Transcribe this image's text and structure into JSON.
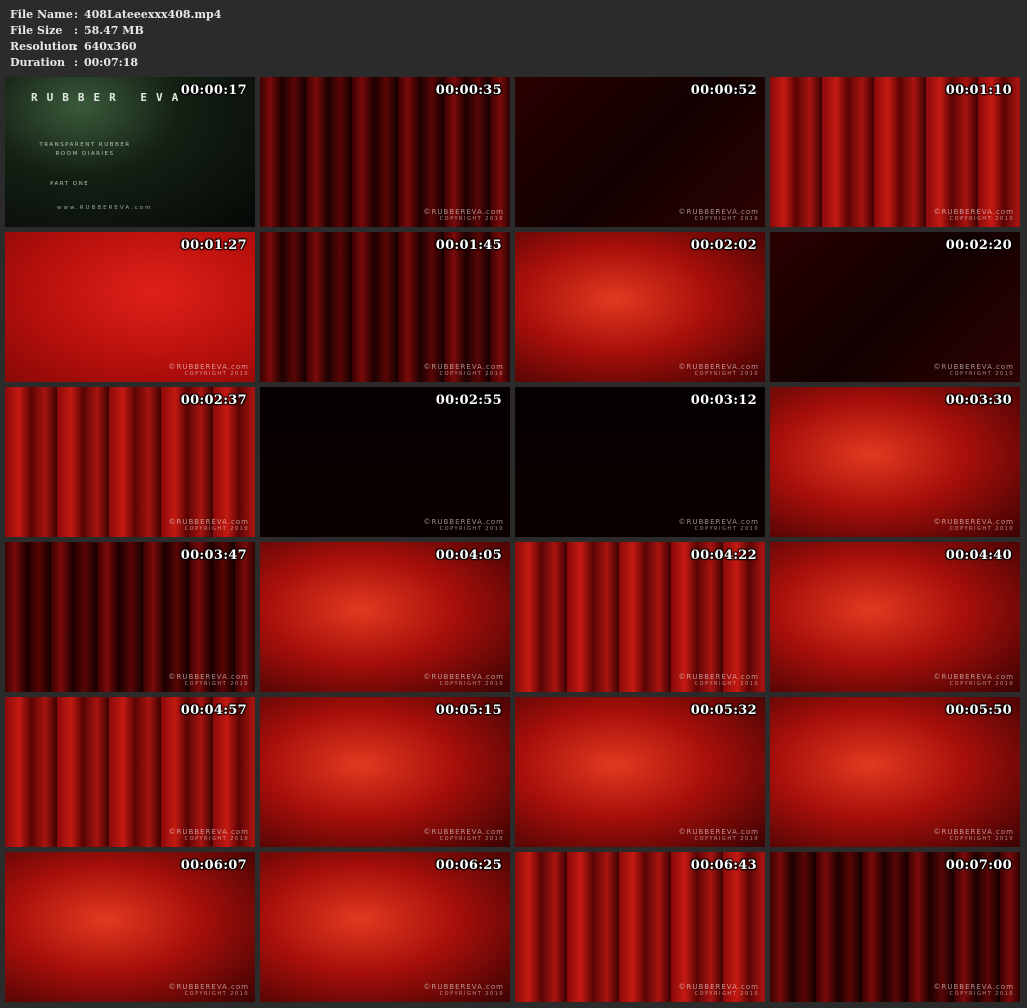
{
  "info": {
    "rows": [
      {
        "label": "File Name",
        "value": "408Lateeexxx408.mp4"
      },
      {
        "label": "File Size",
        "value": "58.47 MB"
      },
      {
        "label": "Resolution",
        "value": "640x360"
      },
      {
        "label": "Duration",
        "value": "00:07:18"
      }
    ],
    "separator": ":"
  },
  "watermark": {
    "brand": "RUBBEREVA",
    "suffix": ".com",
    "copyright": "COPYRIGHT 2010"
  },
  "intro": {
    "title": "RUBBER EVA",
    "subtitle_line1": "TRANSPARENT RUBBER",
    "subtitle_line2": "ROOM DIARIES",
    "part": "PART ONE",
    "url": "www.RUBBEREVA.com"
  },
  "thumbnails": [
    {
      "time": "00:00:17",
      "tone": "intro"
    },
    {
      "time": "00:00:35",
      "tone": "curtain-dark"
    },
    {
      "time": "00:00:52",
      "tone": "dark"
    },
    {
      "time": "00:01:10",
      "tone": "curtain"
    },
    {
      "time": "00:01:27",
      "tone": "red"
    },
    {
      "time": "00:01:45",
      "tone": "curtain-dark"
    },
    {
      "time": "00:02:02",
      "tone": "bright"
    },
    {
      "time": "00:02:20",
      "tone": "dark"
    },
    {
      "time": "00:02:37",
      "tone": "curtain"
    },
    {
      "time": "00:02:55",
      "tone": "black"
    },
    {
      "time": "00:03:12",
      "tone": "black"
    },
    {
      "time": "00:03:30",
      "tone": "bright"
    },
    {
      "time": "00:03:47",
      "tone": "curtain-dark"
    },
    {
      "time": "00:04:05",
      "tone": "bright"
    },
    {
      "time": "00:04:22",
      "tone": "curtain"
    },
    {
      "time": "00:04:40",
      "tone": "bright"
    },
    {
      "time": "00:04:57",
      "tone": "curtain"
    },
    {
      "time": "00:05:15",
      "tone": "bright"
    },
    {
      "time": "00:05:32",
      "tone": "bright"
    },
    {
      "time": "00:05:50",
      "tone": "bright"
    },
    {
      "time": "00:06:07",
      "tone": "bright"
    },
    {
      "time": "00:06:25",
      "tone": "bright"
    },
    {
      "time": "00:06:43",
      "tone": "curtain"
    },
    {
      "time": "00:07:00",
      "tone": "curtain-dark"
    }
  ]
}
